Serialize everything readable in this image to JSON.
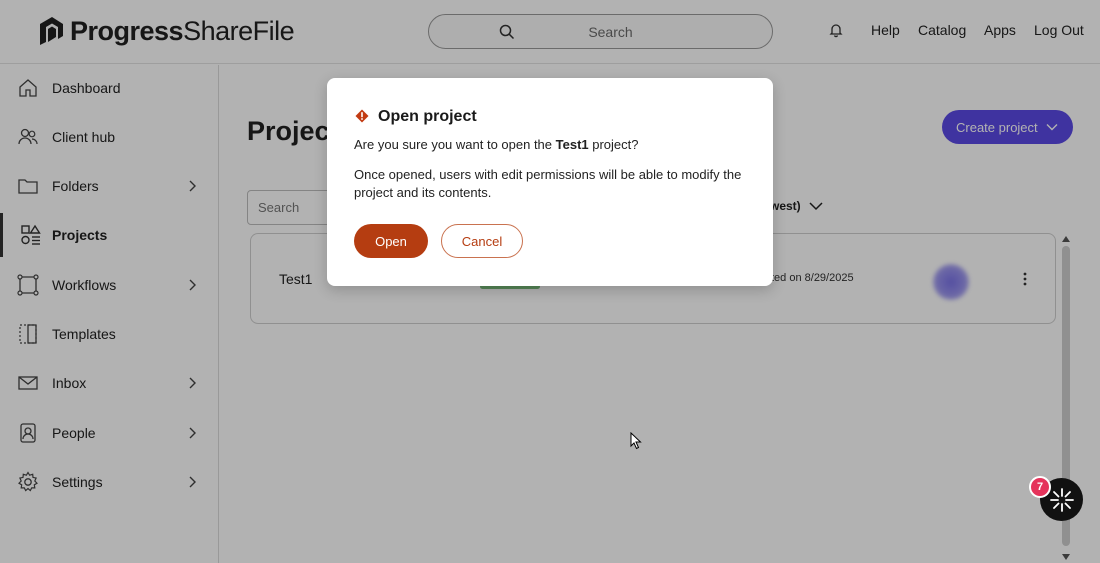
{
  "header": {
    "logo_brand": "Progress",
    "logo_product": "ShareFile",
    "search_placeholder": "Search",
    "nav": [
      "Help",
      "Catalog",
      "Apps",
      "Log Out"
    ]
  },
  "sidebar": {
    "items": [
      {
        "label": "Dashboard",
        "icon": "home-icon",
        "chevron": false
      },
      {
        "label": "Client hub",
        "icon": "users-icon",
        "chevron": false
      },
      {
        "label": "Folders",
        "icon": "folder-icon",
        "chevron": true
      },
      {
        "label": "Projects",
        "icon": "projects-icon",
        "chevron": false,
        "active": true
      },
      {
        "label": "Workflows",
        "icon": "workflow-icon",
        "chevron": true
      },
      {
        "label": "Templates",
        "icon": "template-icon",
        "chevron": false
      },
      {
        "label": "Inbox",
        "icon": "mail-icon",
        "chevron": true
      },
      {
        "label": "People",
        "icon": "person-icon",
        "chevron": true
      },
      {
        "label": "Settings",
        "icon": "gear-icon",
        "chevron": true
      }
    ]
  },
  "main": {
    "title": "Projec",
    "create_button": "Create project",
    "filter_placeholder": "Search",
    "sort_label": "west)",
    "project": {
      "name": "Test1",
      "updated": "ted on 8/29/2025"
    }
  },
  "dialog": {
    "title": "Open project",
    "question_prefix": "Are you sure you want to open the ",
    "question_project": "Test1",
    "question_suffix": " project?",
    "description": "Once opened, users with edit permissions will be able to modify the project and its contents.",
    "open_label": "Open",
    "cancel_label": "Cancel"
  },
  "assistant": {
    "badge_count": "7"
  },
  "colors": {
    "primary": "#5b4ae6",
    "danger": "#b53d11",
    "badge": "#e5335b"
  }
}
